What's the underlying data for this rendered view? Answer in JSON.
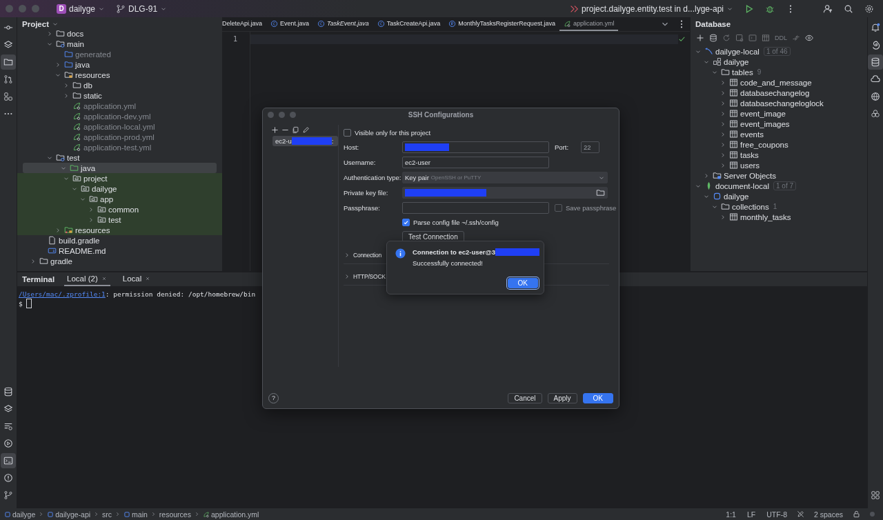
{
  "window": {
    "project_badge": "D",
    "project": "dailyge",
    "branch": "DLG-91",
    "run_config": "project.dailyge.entity.test in d...lyge-api"
  },
  "left_toolbar": {
    "top": [
      {
        "kind": "commit",
        "selected": false
      },
      {
        "kind": "layers",
        "selected": false
      },
      {
        "kind": "folder",
        "selected": true
      },
      {
        "kind": "pull-request",
        "selected": false
      },
      {
        "kind": "structure",
        "selected": false
      },
      {
        "kind": "more",
        "selected": false
      }
    ],
    "bottom": [
      {
        "kind": "database",
        "selected": false
      },
      {
        "kind": "layers",
        "selected": false
      },
      {
        "kind": "services",
        "selected": false
      },
      {
        "kind": "run",
        "selected": false
      },
      {
        "kind": "terminal",
        "selected": true
      },
      {
        "kind": "problems",
        "selected": false
      },
      {
        "kind": "branch",
        "selected": false
      }
    ]
  },
  "right_toolbar": {
    "top": [
      {
        "kind": "bell",
        "selected": false
      },
      {
        "kind": "spiral",
        "selected": false
      },
      {
        "kind": "database",
        "selected": true
      },
      {
        "kind": "cloud",
        "selected": false
      },
      {
        "kind": "globe",
        "selected": false
      },
      {
        "kind": "flower",
        "selected": false
      }
    ],
    "bottom": [
      {
        "kind": "grid",
        "selected": false
      }
    ]
  },
  "project_panel": {
    "title": "Project",
    "tree": [
      {
        "children": [
          {
            "children": [
              {
                "label": "docs",
                "kind": "folder",
                "expanded": false,
                "selected": false,
                "dimmed": false,
                "tinted": false
              },
              {
                "label": "main",
                "kind": "source-root",
                "expanded": true,
                "selected": false,
                "dimmed": false,
                "tinted": false,
                "children": [
                  {
                    "label": "generated",
                    "kind": "generated-folder",
                    "selected": false,
                    "dimmed": true,
                    "tinted": false
                  },
                  {
                    "label": "java",
                    "kind": "source-folder",
                    "expanded": false,
                    "selected": false,
                    "dimmed": false,
                    "tinted": false
                  },
                  {
                    "label": "resources",
                    "kind": "resources-folder",
                    "expanded": true,
                    "selected": false,
                    "dimmed": false,
                    "tinted": false,
                    "children": [
                      {
                        "label": "db",
                        "kind": "folder",
                        "expanded": false,
                        "selected": false,
                        "dimmed": false,
                        "tinted": false
                      },
                      {
                        "label": "static",
                        "kind": "folder",
                        "expanded": false,
                        "selected": false,
                        "dimmed": false,
                        "tinted": false
                      },
                      {
                        "label": "application.yml",
                        "kind": "yml",
                        "selected": false,
                        "dimmed": true,
                        "tinted": false
                      },
                      {
                        "label": "application-dev.yml",
                        "kind": "yml",
                        "selected": false,
                        "dimmed": true,
                        "tinted": false
                      },
                      {
                        "label": "application-local.yml",
                        "kind": "yml",
                        "selected": false,
                        "dimmed": true,
                        "tinted": false
                      },
                      {
                        "label": "application-prod.yml",
                        "kind": "yml",
                        "selected": false,
                        "dimmed": true,
                        "tinted": false
                      },
                      {
                        "label": "application-test.yml",
                        "kind": "yml",
                        "selected": false,
                        "dimmed": true,
                        "tinted": false
                      }
                    ]
                  }
                ]
              },
              {
                "label": "test",
                "kind": "source-root",
                "expanded": true,
                "selected": false,
                "dimmed": false,
                "tinted": false,
                "children": [
                  {
                    "label": "java",
                    "kind": "test-folder",
                    "expanded": true,
                    "selected": true,
                    "dimmed": false,
                    "tinted": true,
                    "children": [
                      {
                        "label": "project",
                        "kind": "package",
                        "expanded": true,
                        "selected": false,
                        "dimmed": false,
                        "tinted": true,
                        "children": [
                          {
                            "label": "dailyge",
                            "kind": "package",
                            "expanded": true,
                            "selected": false,
                            "dimmed": false,
                            "tinted": true,
                            "children": [
                              {
                                "label": "app",
                                "kind": "package",
                                "expanded": true,
                                "selected": false,
                                "dimmed": false,
                                "tinted": true,
                                "children": [
                                  {
                                    "label": "common",
                                    "kind": "package",
                                    "expanded": false,
                                    "selected": false,
                                    "dimmed": false,
                                    "tinted": true
                                  },
                                  {
                                    "label": "test",
                                    "kind": "package",
                                    "expanded": false,
                                    "selected": false,
                                    "dimmed": false,
                                    "tinted": true
                                  }
                                ]
                              }
                            ]
                          }
                        ]
                      }
                    ]
                  },
                  {
                    "label": "resources",
                    "kind": "test-resources-folder",
                    "expanded": false,
                    "selected": false,
                    "dimmed": false,
                    "tinted": true
                  }
                ]
              }
            ]
          },
          {
            "label": "build.gradle",
            "kind": "gradle",
            "selected": false,
            "dimmed": false,
            "tinted": false
          },
          {
            "label": "README.md",
            "kind": "markdown",
            "selected": false,
            "dimmed": false,
            "tinted": false
          }
        ]
      },
      {
        "label": "gradle",
        "kind": "folder",
        "expanded": false,
        "selected": false,
        "dimmed": false,
        "tinted": false
      }
    ]
  },
  "editor": {
    "tabs": [
      {
        "label": "DeleteApi.java",
        "selected": false,
        "italic": false
      },
      {
        "label": "Event.java",
        "kind": "class",
        "selected": false,
        "italic": false
      },
      {
        "label": "TaskEvent.java",
        "kind": "class",
        "selected": false,
        "italic": true
      },
      {
        "label": "TaskCreateApi.java",
        "kind": "class",
        "selected": false,
        "italic": false
      },
      {
        "label": "MonthlyTasksRegisterRequest.java",
        "kind": "record",
        "selected": false,
        "italic": false
      },
      {
        "label": "application.yml",
        "kind": "yml",
        "selected": true,
        "italic": false
      }
    ],
    "line_numbers": [
      "1"
    ]
  },
  "database_panel": {
    "title": "Database",
    "toolbar": [
      {
        "kind": "add",
        "disabled": false
      },
      {
        "kind": "database",
        "disabled": false
      },
      {
        "kind": "refresh",
        "disabled": true
      },
      {
        "kind": "query",
        "disabled": true
      },
      {
        "kind": "console",
        "disabled": true
      },
      {
        "kind": "table",
        "disabled": true
      },
      {
        "kind": "text",
        "label": "DDL",
        "disabled": true
      },
      {
        "kind": "jump",
        "disabled": true
      },
      {
        "kind": "eye",
        "disabled": false
      }
    ],
    "tree": [
      {
        "label": "dailyge-local",
        "kind": "mysql",
        "count": "1 of 46",
        "expanded": true,
        "children": [
          {
            "label": "dailyge",
            "kind": "schema",
            "expanded": true,
            "children": [
              {
                "label": "tables",
                "kind": "folder",
                "count": "9",
                "expanded": true,
                "children": [
                  {
                    "label": "code_and_message",
                    "kind": "table",
                    "expanded": false
                  },
                  {
                    "label": "databasechangelog",
                    "kind": "table",
                    "expanded": false
                  },
                  {
                    "label": "databasechangeloglock",
                    "kind": "table",
                    "expanded": false
                  },
                  {
                    "label": "event_image",
                    "kind": "table",
                    "expanded": false
                  },
                  {
                    "label": "event_images",
                    "kind": "table",
                    "expanded": false
                  },
                  {
                    "label": "events",
                    "kind": "table",
                    "expanded": false
                  },
                  {
                    "label": "free_coupons",
                    "kind": "table",
                    "expanded": false
                  },
                  {
                    "label": "tasks",
                    "kind": "table",
                    "expanded": false
                  },
                  {
                    "label": "users",
                    "kind": "table",
                    "expanded": false
                  }
                ]
              }
            ]
          },
          {
            "label": "Server Objects",
            "kind": "server-objects",
            "expanded": false
          }
        ]
      },
      {
        "label": "document-local",
        "kind": "mongo",
        "count": "1 of 7",
        "expanded": true,
        "children": [
          {
            "label": "dailyge",
            "kind": "mongo-db",
            "expanded": true,
            "children": [
              {
                "label": "collections",
                "kind": "folder",
                "count": "1",
                "expanded": true,
                "children": [
                  {
                    "label": "monthly_tasks",
                    "kind": "table",
                    "expanded": false
                  }
                ]
              }
            ]
          }
        ]
      }
    ]
  },
  "terminal": {
    "title": "Terminal",
    "tabs": [
      {
        "label": "Local (2)",
        "selected": true
      },
      {
        "label": "Local",
        "selected": false
      }
    ],
    "lines": [
      {
        "kind": "error",
        "link": "/Users/mac/.zprofile:1",
        "text": ": permission denied: /opt/homebrew/bin"
      },
      {
        "kind": "prompt",
        "text": "$"
      }
    ]
  },
  "status_bar": {
    "breadcrumbs": [
      {
        "label": "dailyge",
        "kind": "module"
      },
      {
        "label": "dailyge-api",
        "kind": "module"
      },
      {
        "label": "src",
        "kind": "folder"
      },
      {
        "label": "main",
        "kind": "module"
      },
      {
        "label": "resources",
        "kind": "folder"
      },
      {
        "label": "application.yml",
        "kind": "yml"
      }
    ],
    "position": "1:1",
    "line_separator": "LF",
    "encoding": "UTF-8",
    "indent": "2 spaces"
  },
  "ssh_dialog": {
    "title": "SSH Configurations",
    "configs": [
      {
        "label": "ec2-u",
        "redacted": true,
        "suffix": ":",
        "selected": true
      }
    ],
    "visible_only": {
      "label": "Visible only for this project",
      "checked": false
    },
    "host": {
      "label": "Host:",
      "redacted": true
    },
    "port": {
      "label": "Port:",
      "value": "22",
      "disabled": true
    },
    "username": {
      "label": "Username:",
      "value": "ec2-user"
    },
    "auth_type": {
      "label": "Authentication type:",
      "value": "Key pair",
      "hint": "OpenSSH or PuTTY"
    },
    "private_key": {
      "label": "Private key file:",
      "redacted": true
    },
    "passphrase": {
      "label": "Passphrase:"
    },
    "save_passphrase": {
      "label": "Save passphrase",
      "checked": false,
      "disabled": true
    },
    "parse_config": {
      "label": "Parse config file ~/.ssh/config",
      "checked": true
    },
    "test_button": "Test Connection",
    "sections": [
      {
        "label": "Connection",
        "expanded": false
      },
      {
        "label": "HTTP/SOCK",
        "expanded": false
      }
    ],
    "help": "?",
    "buttons": [
      {
        "label": "Cancel",
        "primary": false
      },
      {
        "label": "Apply",
        "primary": false
      },
      {
        "label": "OK",
        "primary": true
      }
    ]
  },
  "message": {
    "title": "Connection to ec2-user@3",
    "redacted": true,
    "text": "Successfully connected!",
    "button": "OK"
  }
}
